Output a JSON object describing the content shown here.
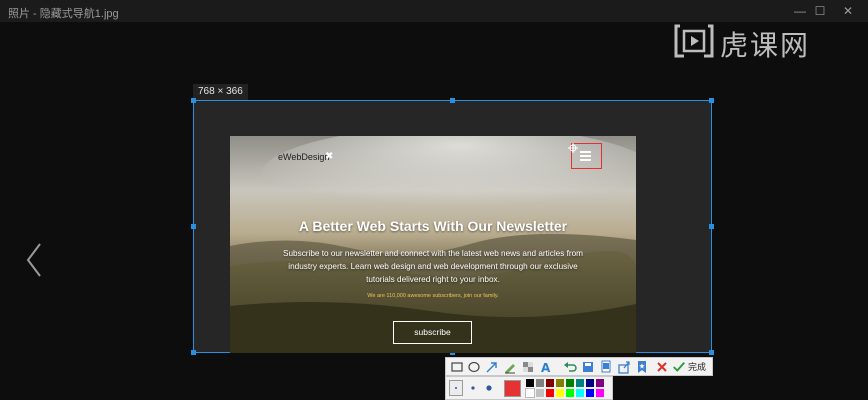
{
  "window": {
    "title": "照片 - 隐藏式导航1.jpg",
    "controls": [
      "—",
      "☐",
      "✕"
    ]
  },
  "brand": {
    "text": "虎课网",
    "icon": "tv-play-logo-icon"
  },
  "selection": {
    "size_label": "768 × 366"
  },
  "photo": {
    "logo": "eWebDesign",
    "headline": "A Better Web Starts With Our Newsletter",
    "body": "Subscribe to our newsletter and connect with the latest web news and articles from industry experts. Learn web design and web development through our exclusive tutorials delivered right to your inbox.",
    "subscribers": "We are 110,000 awesome subscribers, join our family.",
    "subscribe_label": "subscribe"
  },
  "toolbar": {
    "tools": [
      "rectangle-icon",
      "ellipse-icon",
      "arrow-icon",
      "pen-icon",
      "mosaic-icon",
      "text-icon",
      "undo-icon",
      "save-icon",
      "copy-icon",
      "share-icon",
      "pin-icon",
      "cancel-icon"
    ],
    "done_label": "完成"
  },
  "palette": {
    "current_color": "#e53333",
    "colors": [
      "#000000",
      "#808080",
      "#800000",
      "#808000",
      "#008000",
      "#008080",
      "#000080",
      "#800080",
      "#ffffff",
      "#c0c0c0",
      "#ff0000",
      "#ffff00",
      "#00ff00",
      "#00ffff",
      "#0000ff",
      "#ff00ff"
    ]
  }
}
